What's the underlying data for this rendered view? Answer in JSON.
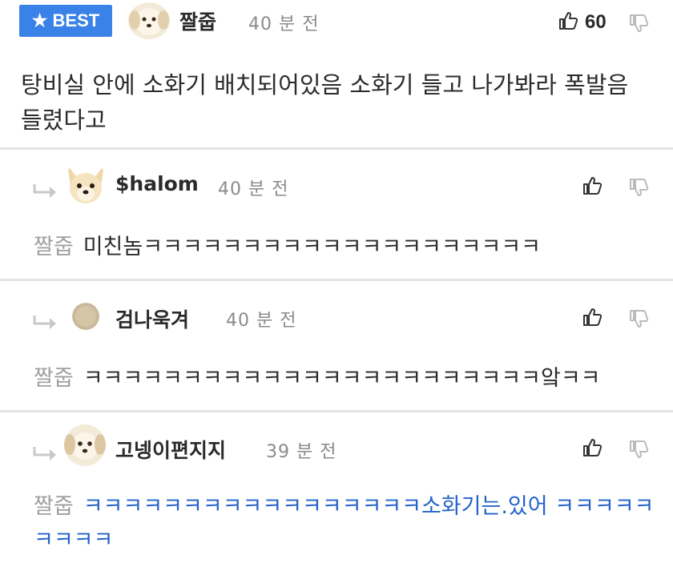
{
  "best": {
    "label": "BEST",
    "icon": "star-icon"
  },
  "main_comment": {
    "author": "짤줍",
    "time": "40 분 전",
    "likes": "60",
    "text": "탕비실 안에 소화기 배치되어있음 소화기 들고 나가봐라 폭발음 들렸다고"
  },
  "replies": [
    {
      "author": "$halom",
      "time": "40 분 전",
      "mention": "짤줍",
      "text": "미친놈ㅋㅋㅋㅋㅋㅋㅋㅋㅋㅋㅋㅋㅋㅋㅋㅋㅋㅋㅋㅋ"
    },
    {
      "author": "검나욱겨",
      "time": "40 분 전",
      "mention": "짤줍",
      "text": "ㅋㅋㅋㅋㅋㅋㅋㅋㅋㅋㅋㅋㅋㅋㅋㅋㅋㅋㅋㅋㅋㅋㅋ앜ㅋㅋ"
    },
    {
      "author": "고넹이편지지",
      "time": "39 분 전",
      "mention": "짤줍",
      "text": "ㅋㅋㅋㅋㅋㅋㅋㅋㅋㅋㅋㅋㅋㅋㅋㅋㅋ소화기는.있어 ㅋㅋㅋㅋㅋㅋㅋㅋㅋ"
    }
  ],
  "colors": {
    "accent": "#3a82e8",
    "link": "#2563c9",
    "muted": "#8a8a8a",
    "divider": "#e4e4e4"
  }
}
